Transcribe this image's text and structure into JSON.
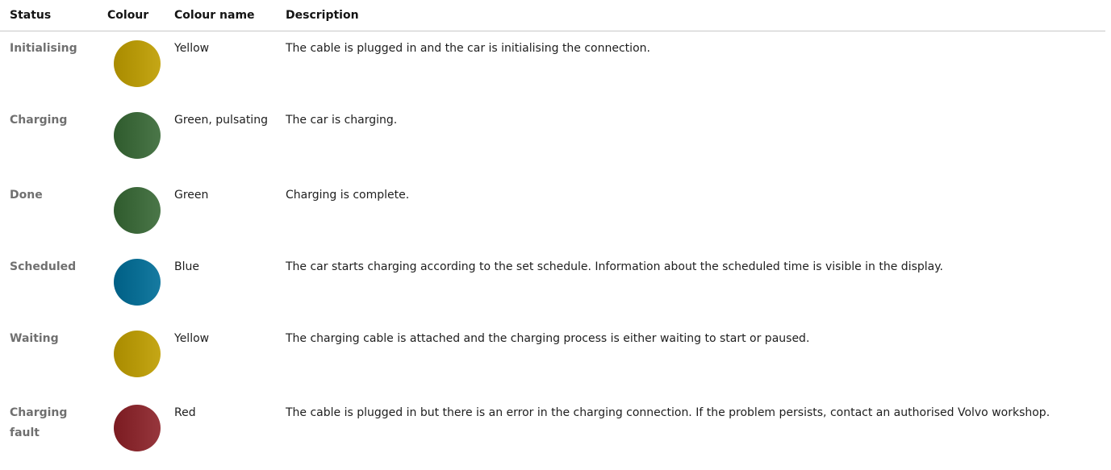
{
  "table": {
    "headers": {
      "status": "Status",
      "colour": "Colour",
      "colour_name": "Colour name",
      "description": "Description"
    },
    "rows": [
      {
        "status": "Initialising",
        "colour_name": "Yellow",
        "colour_hex": "#b89a0a",
        "description": "The cable is plugged in and the car is initialising the connection."
      },
      {
        "status": "Charging",
        "colour_name": "Green, pulsating",
        "colour_hex": "#3e6a3c",
        "description": "The car is charging."
      },
      {
        "status": "Done",
        "colour_name": "Green",
        "colour_hex": "#3e6a3c",
        "description": "Charging is complete."
      },
      {
        "status": "Scheduled",
        "colour_name": "Blue",
        "colour_hex": "#0a6e94",
        "description": "The car starts charging according to the set schedule. Information about the scheduled time is visible in the display."
      },
      {
        "status": "Waiting",
        "colour_name": "Yellow",
        "colour_hex": "#b89a0a",
        "description": "The charging cable is attached and the charging process is either waiting to start or paused."
      },
      {
        "status": "Charging fault",
        "colour_name": "Red",
        "colour_hex": "#8a2a30",
        "description": "The cable is plugged in but there is an error in the charging connection. If the problem persists, contact an authorised Volvo workshop."
      }
    ]
  }
}
